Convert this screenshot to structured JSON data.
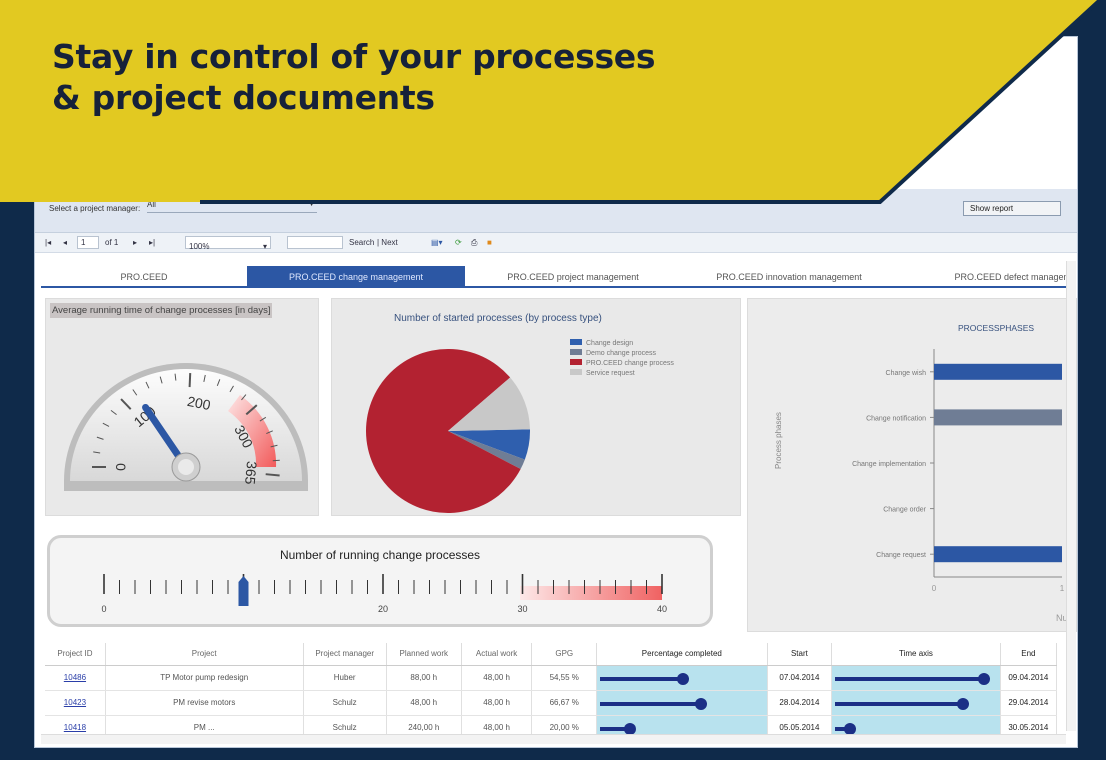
{
  "headline": {
    "line1": "Stay in control of your processes",
    "line2": "& project documents"
  },
  "filter": {
    "label": "Select a project manager:",
    "value": "All",
    "show_report": "Show report"
  },
  "toolbar": {
    "page": "1",
    "of": "of 1",
    "zoom": "100%",
    "search": "Search",
    "next": "| Next"
  },
  "tabs": [
    "PRO.CEED",
    "PRO.CEED change management",
    "PRO.CEED project management",
    "PRO.CEED innovation management",
    "PRO.CEED defect managem"
  ],
  "gauge": {
    "title": "Average running time of change processes [in days]",
    "ticks": [
      "0",
      "100",
      "200",
      "300",
      "365"
    ],
    "value": 110
  },
  "pie": {
    "title": "Number of started processes (by process type)",
    "legend": [
      "Change design",
      "Demo change process",
      "PRO.CEED change process",
      "Service request"
    ],
    "colors": [
      "#2f5fae",
      "#6f7d95",
      "#b32231",
      "#c8c8c8"
    ],
    "values": [
      6,
      2,
      81,
      11
    ]
  },
  "phases": {
    "title": "PROCESSPHASES",
    "ylabel": "Process phases",
    "categories": [
      "Change wish",
      "Change notification",
      "Change implementation",
      "Change order",
      "Change request"
    ],
    "values": [
      1,
      1,
      0,
      0,
      1
    ],
    "bar_colors": [
      "#2c57a4",
      "#6f7d95",
      "#2c57a4",
      "#2c57a4",
      "#2c57a4"
    ],
    "xticks": [
      "0",
      "1"
    ],
    "xlabel": "Num"
  },
  "linear": {
    "title": "Number of running change processes",
    "labels": [
      "0",
      "20",
      "30",
      "40"
    ],
    "value": 10
  },
  "table": {
    "headers": [
      "Project ID",
      "Project",
      "Project manager",
      "Planned work",
      "Actual work",
      "GPG",
      "Percentage completed",
      "Start",
      "Time axis",
      "End"
    ],
    "rows": [
      {
        "id": "10486",
        "project": "TP Motor pump redesign",
        "manager": "Huber",
        "planned": "88,00 h",
        "actual": "48,00 h",
        "gpg": "54,55 %",
        "pct": 0.55,
        "start": "07.04.2014",
        "time": 0.99,
        "end": "09.04.2014"
      },
      {
        "id": "10423",
        "project": "PM revise motors",
        "manager": "Schulz",
        "planned": "48,00 h",
        "actual": "48,00 h",
        "gpg": "66,67 %",
        "pct": 0.67,
        "start": "28.04.2014",
        "time": 0.85,
        "end": "29.04.2014"
      },
      {
        "id": "10418",
        "project": "PM ...",
        "manager": "Schulz",
        "planned": "240,00 h",
        "actual": "48,00 h",
        "gpg": "20,00 %",
        "pct": 0.2,
        "start": "05.05.2014",
        "time": 0.1,
        "end": "30.05.2014"
      }
    ]
  }
}
